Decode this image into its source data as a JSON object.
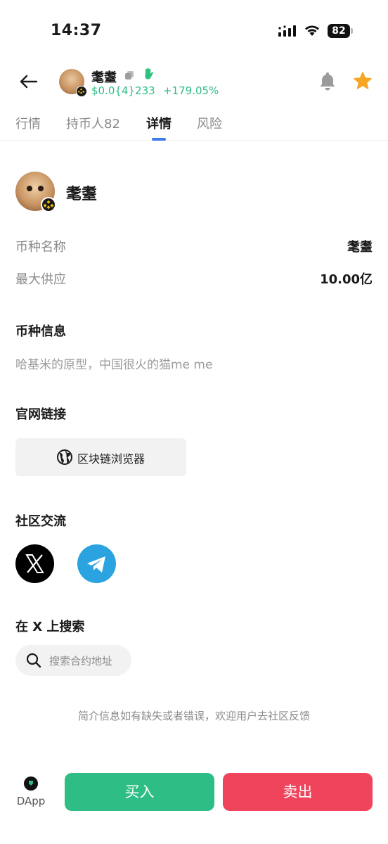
{
  "status_bar": {
    "time": "14:37",
    "battery": "82"
  },
  "header": {
    "token_name": "耄耋",
    "price": "$0.0{4}233",
    "change": "+179.05%"
  },
  "tabs": [
    {
      "label": "行情"
    },
    {
      "label": "持币人82"
    },
    {
      "label": "详情"
    },
    {
      "label": "风险"
    }
  ],
  "detail": {
    "token_title": "耄耋",
    "rows": [
      {
        "label": "币种名称",
        "value": "耄耋"
      },
      {
        "label": "最大供应",
        "value": "10.00亿"
      }
    ],
    "info_title": "币种信息",
    "info_desc": "哈基米的原型，中国很火的猫me me",
    "website_title": "官网链接",
    "explorer_label": "区块链浏览器",
    "community_title": "社区交流",
    "search_title": "在 X 上搜索",
    "search_placeholder": "搜索合约地址",
    "disclaimer": "简介信息如有缺失或者错误，欢迎用户去社区反馈"
  },
  "bottom": {
    "dapp_label": "DApp",
    "buy_label": "买入",
    "sell_label": "卖出"
  },
  "colors": {
    "accent_green": "#2ebd85",
    "accent_red": "#f0445c",
    "tab_indicator": "#3d7bf5",
    "star": "#f5a623"
  }
}
